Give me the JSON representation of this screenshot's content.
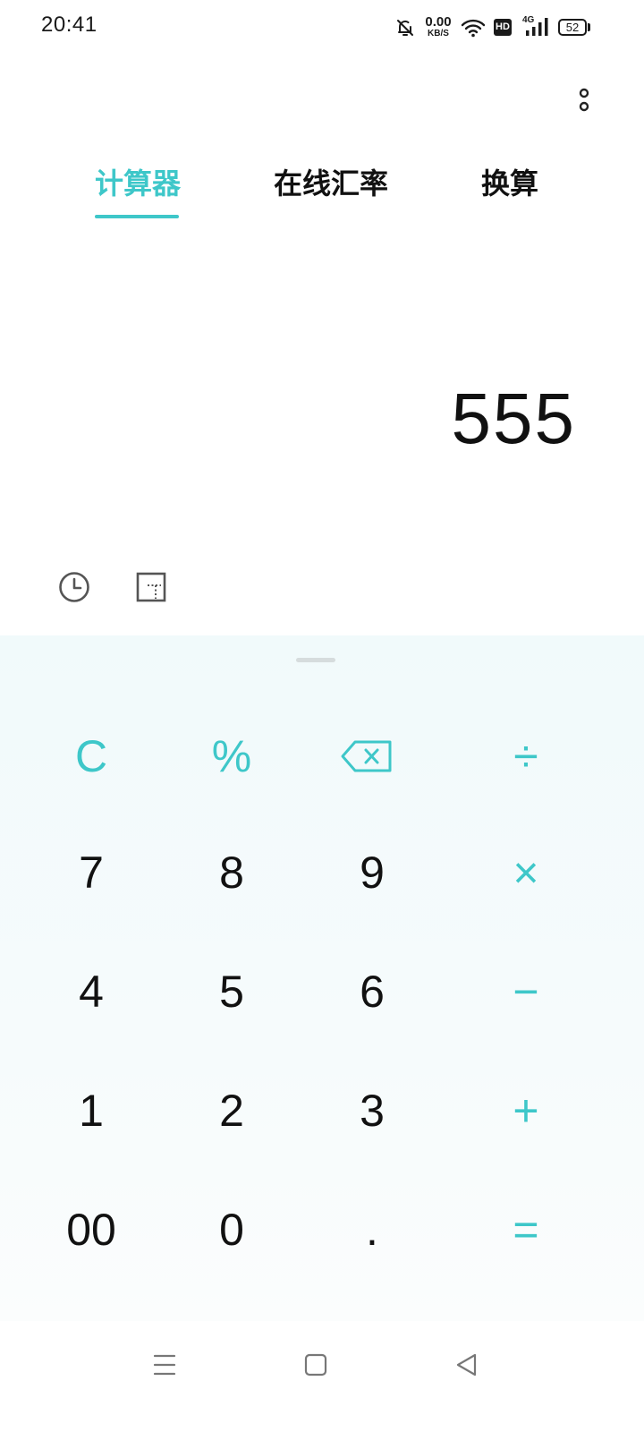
{
  "status_bar": {
    "time": "20:41",
    "net_speed_value": "0.00",
    "net_speed_unit": "KB/S",
    "hd_label": "HD",
    "signal_label": "4G",
    "battery_level": "52"
  },
  "tabs": [
    {
      "label": "计算器",
      "active": true
    },
    {
      "label": "在线汇率",
      "active": false
    },
    {
      "label": "换算",
      "active": false
    }
  ],
  "display": {
    "value": "555"
  },
  "keys": {
    "clear": "C",
    "percent": "%",
    "divide": "÷",
    "seven": "7",
    "eight": "8",
    "nine": "9",
    "multiply": "×",
    "four": "4",
    "five": "5",
    "six": "6",
    "minus": "−",
    "one": "1",
    "two": "2",
    "three": "3",
    "plus": "+",
    "double_zero": "00",
    "zero": "0",
    "dot": ".",
    "equals": "="
  },
  "colors": {
    "accent": "#3ec7c9",
    "text": "#111111",
    "keypad_bg": "#f3fafb"
  },
  "icons": {
    "mute": "bell-off-icon",
    "wifi": "wifi-icon",
    "signal": "cell-signal-icon",
    "history": "clock-icon",
    "scientific": "scientific-mode-icon",
    "backspace": "backspace-icon",
    "more": "more-vertical-icon",
    "nav_menu": "menu-icon",
    "nav_home": "home-icon",
    "nav_back": "back-icon"
  }
}
